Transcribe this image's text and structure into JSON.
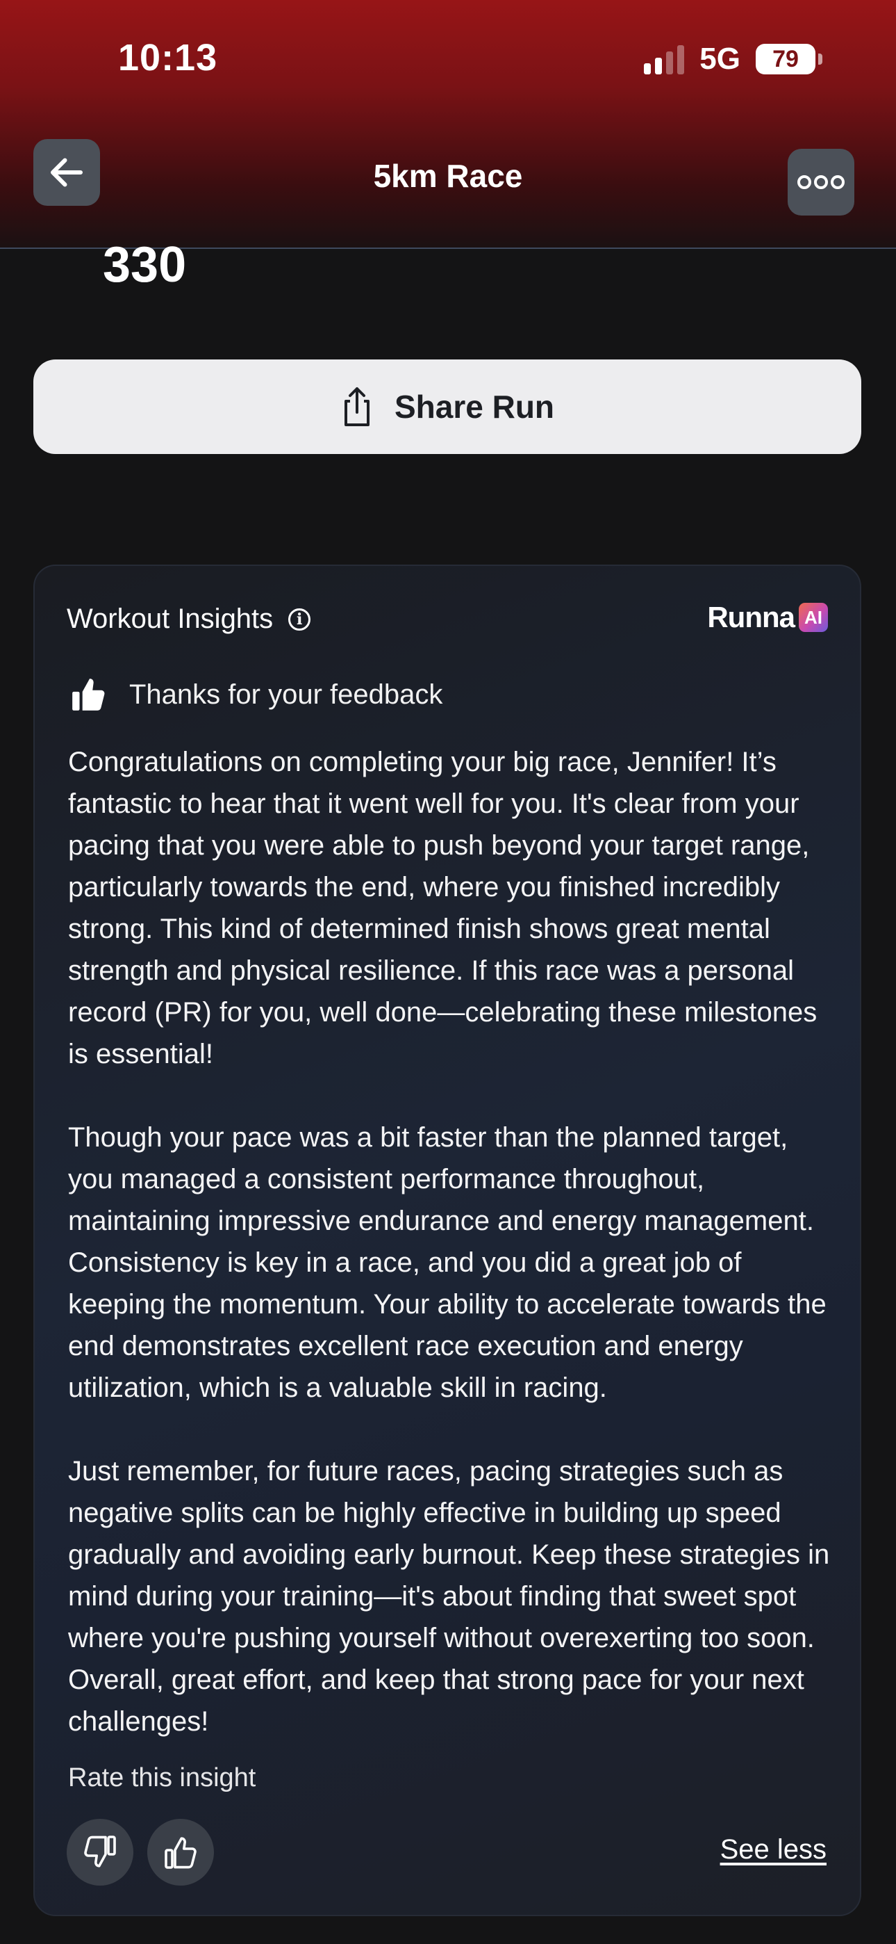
{
  "status_bar": {
    "time": "10:13",
    "network": "5G",
    "battery": "79"
  },
  "header": {
    "title": "5km Race",
    "back_icon": "arrow-left-icon",
    "more_icon": "more-dots-icon"
  },
  "stat": {
    "value": "330"
  },
  "share": {
    "label": "Share Run",
    "icon": "share-icon"
  },
  "insights": {
    "title": "Workout Insights",
    "brand": "Runna",
    "brand_badge": "AI",
    "feedback_text": "Thanks for your feedback",
    "paragraphs": [
      "Congratulations on completing your big race, Jennifer! It’s fantastic to hear that it went well for you. It's clear from your pacing that you were able to push beyond your target range, particularly towards the end, where you finished incredibly strong. This kind of determined finish shows great mental strength and physical resilience. If this race was a personal record (PR) for you, well done—celebrating these milestones is essential!",
      "Though your pace was a bit faster than the planned target, you managed a consistent performance throughout, maintaining impressive endurance and energy management. Consistency is key in a race, and you did a great job of keeping the momentum. Your ability to accelerate towards the end demonstrates excellent race execution and energy utilization, which is a valuable skill in racing.",
      "Just remember, for future races, pacing strategies such as negative splits can be highly effective in building up speed gradually and avoiding early burnout. Keep these strategies in mind during your training—it's about finding that sweet spot where you're pushing yourself without overexerting too soon. Overall, great effort, and keep that strong pace for your next challenges!"
    ],
    "rate_label": "Rate this insight",
    "see_less_label": "See less"
  }
}
